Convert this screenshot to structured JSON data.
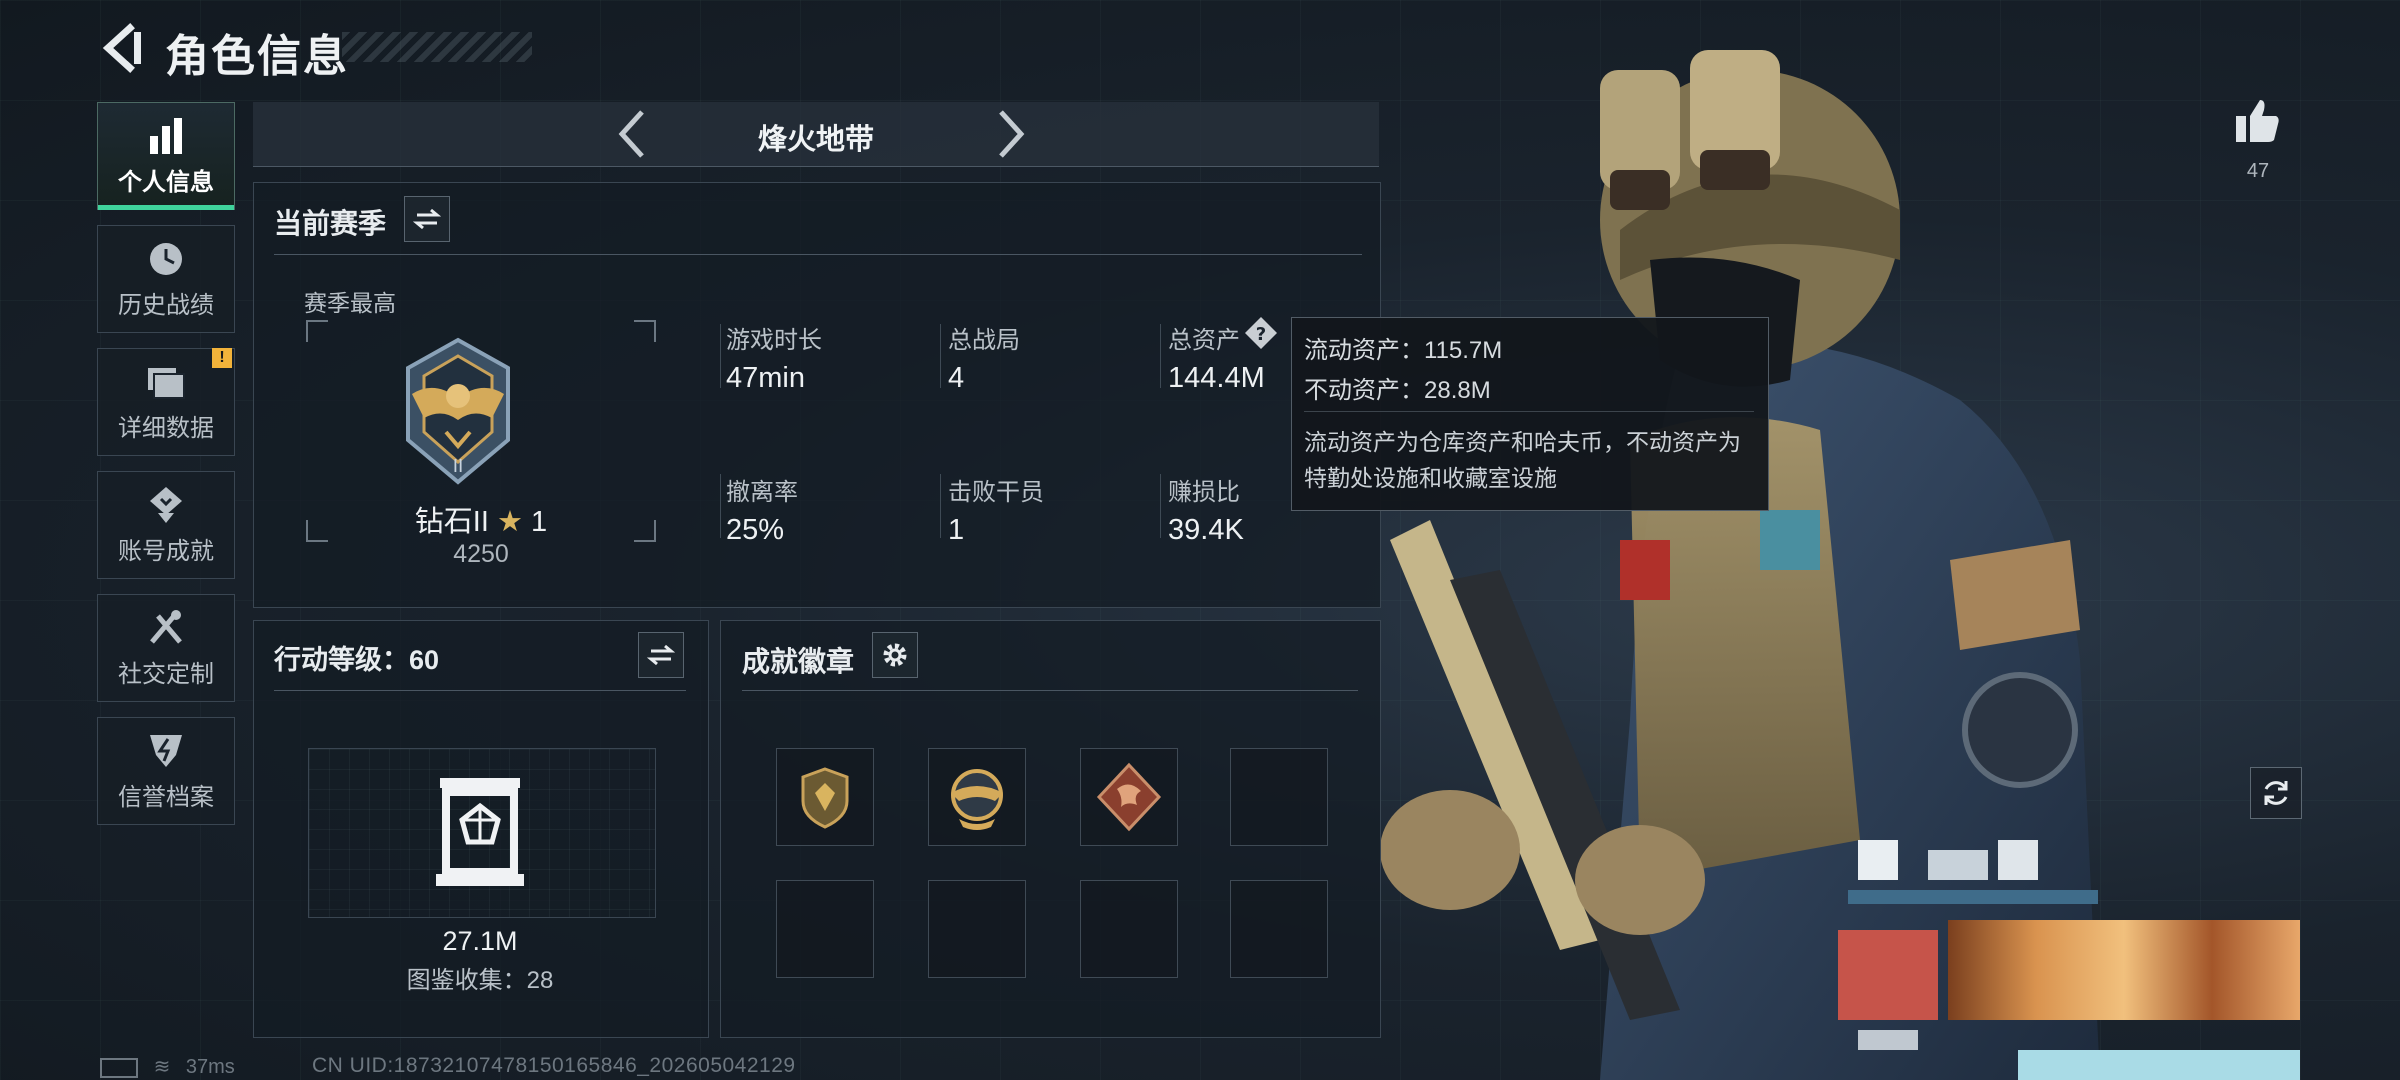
{
  "header": {
    "title": "角色信息"
  },
  "sidebar": {
    "items": [
      {
        "label": "个人信息",
        "icon": "bar-chart-icon",
        "active": true
      },
      {
        "label": "历史战绩",
        "icon": "clock-icon"
      },
      {
        "label": "详细数据",
        "icon": "folder-icon",
        "badge": "!"
      },
      {
        "label": "账号成就",
        "icon": "medal-icon"
      },
      {
        "label": "社交定制",
        "icon": "tools-icon"
      },
      {
        "label": "信誉档案",
        "icon": "shield-bolt-icon"
      }
    ]
  },
  "mode_selector": {
    "title": "烽火地带"
  },
  "season": {
    "heading": "当前赛季",
    "best_label": "赛季最高",
    "rank_name": "钻石II",
    "rank_stars": "1",
    "rank_points": "4250",
    "stats": [
      {
        "label": "游戏时长",
        "value": "47min"
      },
      {
        "label": "总战局",
        "value": "4"
      },
      {
        "label": "总资产",
        "value": "144.4M"
      },
      {
        "label": "撤离率",
        "value": "25%"
      },
      {
        "label": "击败干员",
        "value": "1"
      },
      {
        "label": "赚损比",
        "value": "39.4K"
      }
    ],
    "tooltip": {
      "line1": "流动资产：115.7M",
      "line2": "不动资产：28.8M",
      "desc": "流动资产为仓库资产和哈夫币，不动资产为特勤处设施和收藏室设施"
    }
  },
  "action_level": {
    "heading": "行动等级：60",
    "collection_value": "27.1M",
    "collection_label": "图鉴收集：28"
  },
  "achievements": {
    "heading": "成就徽章",
    "badges": [
      "shield-badge-icon",
      "winged-badge-icon",
      "dragon-badge-icon",
      "",
      "",
      "",
      "",
      ""
    ]
  },
  "character": {
    "likes": "47"
  },
  "footer": {
    "ping": "37ms",
    "uid": "CN UID:18732107478150165846_202605042129"
  },
  "colors": {
    "accent": "#3fd39b",
    "badge_warning": "#f2b33a",
    "background": "#1a232d"
  }
}
